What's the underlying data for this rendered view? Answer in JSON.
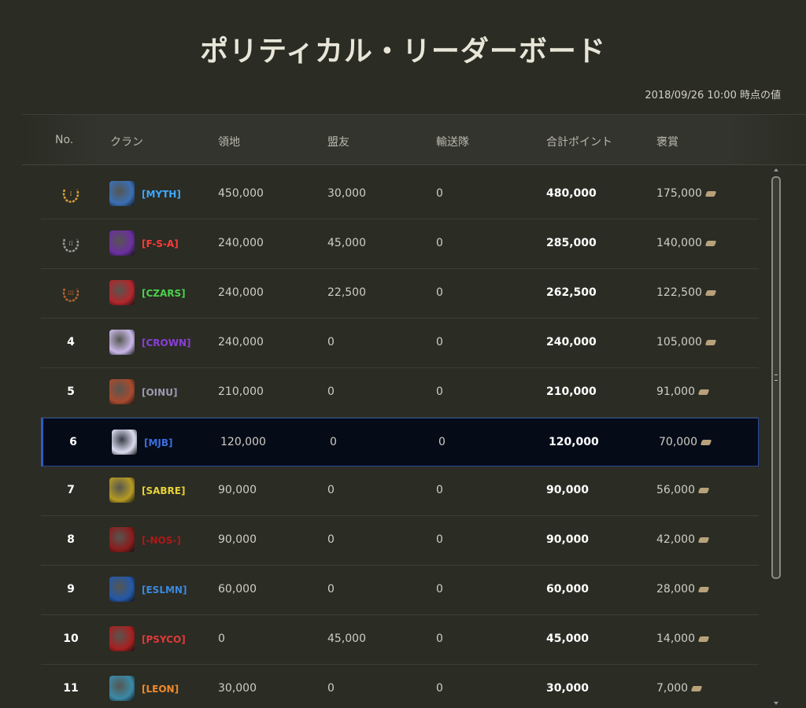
{
  "title": "ポリティカル・リーダーボード",
  "timestamp": "2018/09/26 10:00 時点の値",
  "headers": {
    "no": "No.",
    "clan": "クラン",
    "territory": "領地",
    "allies": "盟友",
    "convoy": "輸送隊",
    "total": "合計ポイント",
    "reward": "褒賞"
  },
  "rows": [
    {
      "rank": "",
      "laurel": "gold",
      "tag": "[MYTH]",
      "tag_color": "#3ea8ff",
      "emblem_color": "#3a6fb5",
      "territory": "450,000",
      "allies": "30,000",
      "convoy": "0",
      "total": "480,000",
      "reward": "175,000"
    },
    {
      "rank": "",
      "laurel": "silver",
      "tag": "[F-S-A]",
      "tag_color": "#ff3a3a",
      "emblem_color": "#6b2fa0",
      "territory": "240,000",
      "allies": "45,000",
      "convoy": "0",
      "total": "285,000",
      "reward": "140,000"
    },
    {
      "rank": "",
      "laurel": "bronze",
      "tag": "[CZARS]",
      "tag_color": "#4cd14c",
      "emblem_color": "#b3262b",
      "territory": "240,000",
      "allies": "22,500",
      "convoy": "0",
      "total": "262,500",
      "reward": "122,500"
    },
    {
      "rank": "4",
      "laurel": "",
      "tag": "[CROWN]",
      "tag_color": "#8a3fd6",
      "emblem_color": "#c9b8e8",
      "territory": "240,000",
      "allies": "0",
      "convoy": "0",
      "total": "240,000",
      "reward": "105,000"
    },
    {
      "rank": "5",
      "laurel": "",
      "tag": "[OINU]",
      "tag_color": "#9a9ab0",
      "emblem_color": "#a84a2e",
      "territory": "210,000",
      "allies": "0",
      "convoy": "0",
      "total": "210,000",
      "reward": "91,000"
    },
    {
      "rank": "6",
      "laurel": "",
      "tag": "[MJB]",
      "tag_color": "#3a6fe0",
      "emblem_color": "#dcdcf0",
      "territory": "120,000",
      "allies": "0",
      "convoy": "0",
      "total": "120,000",
      "reward": "70,000",
      "highlight": true
    },
    {
      "rank": "7",
      "laurel": "",
      "tag": "[SABRE]",
      "tag_color": "#e8d23a",
      "emblem_color": "#b59a22",
      "territory": "90,000",
      "allies": "0",
      "convoy": "0",
      "total": "90,000",
      "reward": "56,000"
    },
    {
      "rank": "8",
      "laurel": "",
      "tag": "[-NOS-]",
      "tag_color": "#b01818",
      "emblem_color": "#8a1c1c",
      "territory": "90,000",
      "allies": "0",
      "convoy": "0",
      "total": "90,000",
      "reward": "42,000"
    },
    {
      "rank": "9",
      "laurel": "",
      "tag": "[ESLMN]",
      "tag_color": "#3a8ae0",
      "emblem_color": "#2458a8",
      "territory": "60,000",
      "allies": "0",
      "convoy": "0",
      "total": "60,000",
      "reward": "28,000"
    },
    {
      "rank": "10",
      "laurel": "",
      "tag": "[PSYCO]",
      "tag_color": "#e03a3a",
      "emblem_color": "#a82020",
      "territory": "0",
      "allies": "45,000",
      "convoy": "0",
      "total": "45,000",
      "reward": "14,000"
    },
    {
      "rank": "11",
      "laurel": "",
      "tag": "[LEON]",
      "tag_color": "#f08a2a",
      "emblem_color": "#3a8aa8",
      "territory": "30,000",
      "allies": "0",
      "convoy": "0",
      "total": "30,000",
      "reward": "7,000"
    }
  ],
  "laurel_colors": {
    "gold": "#d9a037",
    "silver": "#9a9a9a",
    "bronze": "#b5652e"
  },
  "laurel_numerals": {
    "gold": "I",
    "silver": "II",
    "bronze": "III"
  }
}
